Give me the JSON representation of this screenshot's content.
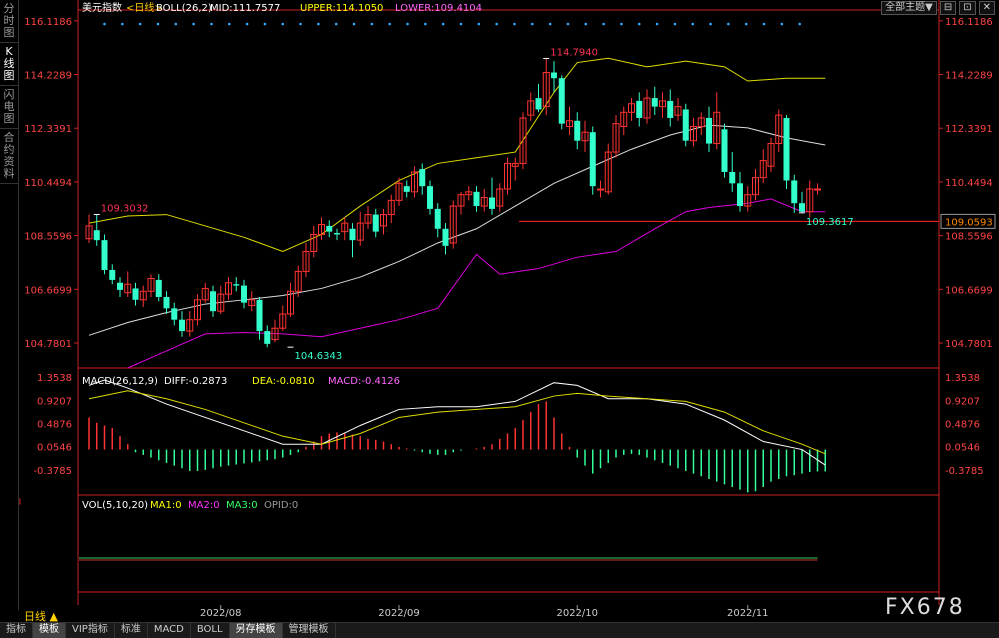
{
  "sidebar": {
    "tabs": [
      {
        "label": "分时图"
      },
      {
        "label": "K线图"
      },
      {
        "label": "闪电图"
      },
      {
        "label": "合约资料"
      }
    ]
  },
  "topbar": {
    "theme_button": "全部主题▼",
    "btn1": "⊟",
    "btn2": "⊡",
    "btn3": "✕"
  },
  "bottom": {
    "period_label": "日线 ▲",
    "tabs": [
      {
        "label": "指标"
      },
      {
        "label": "模板"
      },
      {
        "label": "VIP指标"
      },
      {
        "label": "标准"
      },
      {
        "label": "MACD"
      },
      {
        "label": "BOLL"
      },
      {
        "label": "另存模板"
      },
      {
        "label": "管理模板"
      }
    ],
    "watermark": "FX678"
  },
  "chart_data": {
    "type": "candlestick",
    "main": {
      "symbol": "美元指数",
      "period": "<日线>",
      "boll_label": "BOLL(26,2)",
      "mid_label": "MID:111.7577",
      "upper_label": "UPPER:114.1050",
      "lower_label": "LOWER:109.4104",
      "ylim": [
        103.9,
        116.5
      ],
      "yticks": [
        "116.1186",
        "114.2289",
        "112.3391",
        "110.4494",
        "108.5596",
        "106.6699",
        "104.7801"
      ],
      "current_price": "109.0593",
      "hline": 109.06,
      "annotations": [
        {
          "text": "114.7940",
          "index": 59,
          "value": 114.794
        },
        {
          "text": "109.3032",
          "index": 1,
          "value": 109.3032
        },
        {
          "text": "104.6343",
          "index": 26,
          "value": 104.6343
        },
        {
          "text": "109.3617",
          "index": 92,
          "value": 109.3617
        }
      ],
      "candles": [
        [
          108.45,
          108.9,
          108.3,
          109.3
        ],
        [
          108.75,
          108.4,
          108.2,
          109.3
        ],
        [
          108.4,
          107.35,
          107.2,
          108.6
        ],
        [
          107.35,
          107.0,
          106.85,
          107.55
        ],
        [
          106.9,
          106.65,
          106.4,
          107.1
        ],
        [
          106.55,
          106.85,
          106.4,
          107.3
        ],
        [
          106.7,
          106.3,
          106.1,
          106.9
        ],
        [
          106.3,
          106.6,
          106.05,
          106.8
        ],
        [
          106.6,
          107.05,
          106.4,
          107.2
        ],
        [
          107.0,
          106.4,
          106.25,
          107.2
        ],
        [
          106.4,
          106.0,
          105.8,
          106.6
        ],
        [
          106.0,
          105.6,
          105.4,
          106.2
        ],
        [
          105.6,
          105.2,
          105.0,
          105.9
        ],
        [
          105.2,
          105.6,
          105.0,
          105.9
        ],
        [
          105.6,
          106.3,
          105.4,
          106.5
        ],
        [
          106.3,
          106.7,
          106.2,
          106.9
        ],
        [
          106.6,
          105.9,
          105.7,
          106.8
        ],
        [
          105.9,
          106.5,
          105.8,
          106.8
        ],
        [
          106.5,
          106.9,
          106.3,
          107.1
        ],
        [
          106.85,
          106.8,
          106.6,
          107.1
        ],
        [
          106.8,
          106.2,
          106.0,
          107.0
        ],
        [
          106.1,
          106.3,
          105.9,
          106.6
        ],
        [
          106.3,
          105.2,
          104.9,
          106.4
        ],
        [
          105.2,
          104.75,
          104.63,
          105.4
        ],
        [
          104.9,
          105.3,
          104.8,
          105.6
        ],
        [
          105.3,
          105.8,
          105.2,
          106.1
        ],
        [
          105.8,
          106.6,
          105.7,
          106.9
        ],
        [
          106.6,
          107.3,
          106.4,
          107.5
        ],
        [
          107.3,
          108.0,
          107.1,
          108.3
        ],
        [
          108.0,
          108.6,
          107.8,
          108.9
        ],
        [
          108.6,
          108.95,
          108.4,
          109.2
        ],
        [
          108.9,
          108.7,
          108.5,
          109.1
        ],
        [
          108.65,
          108.6,
          108.4,
          108.8
        ],
        [
          108.7,
          109.0,
          108.4,
          109.2
        ],
        [
          108.8,
          108.4,
          107.8,
          109.0
        ],
        [
          108.4,
          109.0,
          108.2,
          109.4
        ],
        [
          109.0,
          109.3,
          108.8,
          109.6
        ],
        [
          109.3,
          108.7,
          108.5,
          109.5
        ],
        [
          108.9,
          109.3,
          108.6,
          109.5
        ],
        [
          109.3,
          109.8,
          109.0,
          110.0
        ],
        [
          109.8,
          110.4,
          109.6,
          110.6
        ],
        [
          110.3,
          110.1,
          109.9,
          110.5
        ],
        [
          110.1,
          110.8,
          109.9,
          111.0
        ],
        [
          110.9,
          110.3,
          110.0,
          111.1
        ],
        [
          110.3,
          109.5,
          109.3,
          110.5
        ],
        [
          109.5,
          108.8,
          108.5,
          109.7
        ],
        [
          108.8,
          108.2,
          107.9,
          109.0
        ],
        [
          108.3,
          109.6,
          108.1,
          109.8
        ],
        [
          109.6,
          110.0,
          109.3,
          110.1
        ],
        [
          110.0,
          110.1,
          109.8,
          110.3
        ],
        [
          110.1,
          109.6,
          109.4,
          110.3
        ],
        [
          109.6,
          109.9,
          109.4,
          110.2
        ],
        [
          109.9,
          109.5,
          109.3,
          110.6
        ],
        [
          109.6,
          110.2,
          109.4,
          110.4
        ],
        [
          110.2,
          111.1,
          110.0,
          111.3
        ],
        [
          111.0,
          111.1,
          110.5,
          111.3
        ],
        [
          111.1,
          112.7,
          110.9,
          112.9
        ],
        [
          112.8,
          113.3,
          112.6,
          113.6
        ],
        [
          113.4,
          113.0,
          112.9,
          113.9
        ],
        [
          113.1,
          114.3,
          112.8,
          114.79
        ],
        [
          114.3,
          114.1,
          113.6,
          114.7
        ],
        [
          114.1,
          112.5,
          112.3,
          114.2
        ],
        [
          112.4,
          112.6,
          112.1,
          113.1
        ],
        [
          112.6,
          111.9,
          111.6,
          112.9
        ],
        [
          111.9,
          112.2,
          111.5,
          112.6
        ],
        [
          112.2,
          110.3,
          110.0,
          112.4
        ],
        [
          110.2,
          110.2,
          109.9,
          110.5
        ],
        [
          110.1,
          111.5,
          110.0,
          111.8
        ],
        [
          111.5,
          112.5,
          111.3,
          112.8
        ],
        [
          112.4,
          112.9,
          112.1,
          113.1
        ],
        [
          112.9,
          113.2,
          112.6,
          113.4
        ],
        [
          113.3,
          112.7,
          112.4,
          113.6
        ],
        [
          112.7,
          113.4,
          112.5,
          113.7
        ],
        [
          113.4,
          113.1,
          112.8,
          113.8
        ],
        [
          113.1,
          113.3,
          112.7,
          113.6
        ],
        [
          113.3,
          112.7,
          112.4,
          113.7
        ],
        [
          112.8,
          113.1,
          112.6,
          113.4
        ],
        [
          113.0,
          111.9,
          111.7,
          113.2
        ],
        [
          111.9,
          112.4,
          111.7,
          112.7
        ],
        [
          112.4,
          112.7,
          112.1,
          112.9
        ],
        [
          112.7,
          111.8,
          111.5,
          113.1
        ],
        [
          111.8,
          112.9,
          111.6,
          113.6
        ],
        [
          112.3,
          110.8,
          110.6,
          112.5
        ],
        [
          110.8,
          110.4,
          110.1,
          111.5
        ],
        [
          110.4,
          109.6,
          109.4,
          110.8
        ],
        [
          109.6,
          110.0,
          109.4,
          110.3
        ],
        [
          110.0,
          110.6,
          109.8,
          110.9
        ],
        [
          110.6,
          111.2,
          110.4,
          111.6
        ],
        [
          111.0,
          111.8,
          110.8,
          112.0
        ],
        [
          111.8,
          112.8,
          111.5,
          113.0
        ],
        [
          112.7,
          110.5,
          110.2,
          112.8
        ],
        [
          110.5,
          109.7,
          109.36,
          110.7
        ],
        [
          109.7,
          109.4,
          109.36,
          110.1
        ],
        [
          109.4,
          110.2,
          109.2,
          110.5
        ],
        [
          110.2,
          110.2,
          110.0,
          110.4
        ]
      ],
      "mid": [
        [
          0,
          105.05
        ],
        [
          5,
          105.5
        ],
        [
          10,
          105.85
        ],
        [
          15,
          106.15
        ],
        [
          20,
          106.3
        ],
        [
          25,
          106.45
        ],
        [
          30,
          106.7
        ],
        [
          35,
          107.1
        ],
        [
          40,
          107.65
        ],
        [
          45,
          108.3
        ],
        [
          50,
          108.8
        ],
        [
          55,
          109.6
        ],
        [
          60,
          110.4
        ],
        [
          65,
          111.0
        ],
        [
          70,
          111.6
        ],
        [
          75,
          112.1
        ],
        [
          80,
          112.45
        ],
        [
          85,
          112.35
        ],
        [
          90,
          112.0
        ],
        [
          95,
          111.75
        ]
      ],
      "upper": [
        [
          0,
          109.0
        ],
        [
          5,
          109.25
        ],
        [
          10,
          109.3
        ],
        [
          15,
          108.9
        ],
        [
          20,
          108.5
        ],
        [
          25,
          108.0
        ],
        [
          30,
          108.6
        ],
        [
          35,
          109.6
        ],
        [
          40,
          110.5
        ],
        [
          45,
          111.1
        ],
        [
          50,
          111.3
        ],
        [
          55,
          111.5
        ],
        [
          60,
          113.6
        ],
        [
          63,
          114.65
        ],
        [
          67,
          114.8
        ],
        [
          72,
          114.5
        ],
        [
          77,
          114.7
        ],
        [
          82,
          114.5
        ],
        [
          85,
          114.0
        ],
        [
          90,
          114.1
        ],
        [
          95,
          114.1
        ]
      ],
      "lower": [
        [
          5,
          103.9
        ],
        [
          10,
          104.5
        ],
        [
          15,
          105.1
        ],
        [
          20,
          105.15
        ],
        [
          25,
          105.1
        ],
        [
          30,
          105.0
        ],
        [
          35,
          105.3
        ],
        [
          40,
          105.6
        ],
        [
          45,
          106.0
        ],
        [
          50,
          107.9
        ],
        [
          53,
          107.2
        ],
        [
          58,
          107.4
        ],
        [
          63,
          107.8
        ],
        [
          68,
          108.0
        ],
        [
          73,
          108.8
        ],
        [
          77,
          109.4
        ],
        [
          80,
          109.55
        ],
        [
          85,
          109.7
        ],
        [
          88,
          109.85
        ],
        [
          92,
          109.4
        ],
        [
          95,
          109.4
        ]
      ],
      "dots_count": 40
    },
    "macd": {
      "label": "MACD(26,12,9)",
      "diff_label": "DIFF:-0.2873",
      "dea_label": "DEA:-0.0810",
      "macd_label": "MACD:-0.4126",
      "ylim": [
        -0.85,
        1.45
      ],
      "yticks": [
        "1.3538",
        "0.9207",
        "0.4876",
        "0.0546",
        "-0.3785"
      ],
      "diff": [
        [
          0,
          1.2
        ],
        [
          2,
          1.3
        ],
        [
          5,
          1.15
        ],
        [
          10,
          0.85
        ],
        [
          15,
          0.6
        ],
        [
          20,
          0.35
        ],
        [
          25,
          0.1
        ],
        [
          30,
          0.1
        ],
        [
          35,
          0.45
        ],
        [
          40,
          0.75
        ],
        [
          45,
          0.8
        ],
        [
          50,
          0.8
        ],
        [
          55,
          0.9
        ],
        [
          60,
          1.25
        ],
        [
          63,
          1.2
        ],
        [
          67,
          0.95
        ],
        [
          72,
          0.95
        ],
        [
          77,
          0.85
        ],
        [
          82,
          0.55
        ],
        [
          87,
          0.15
        ],
        [
          92,
          0.0
        ],
        [
          95,
          -0.29
        ]
      ],
      "dea": [
        [
          0,
          0.95
        ],
        [
          5,
          1.1
        ],
        [
          10,
          0.95
        ],
        [
          15,
          0.75
        ],
        [
          20,
          0.5
        ],
        [
          25,
          0.25
        ],
        [
          30,
          0.1
        ],
        [
          35,
          0.3
        ],
        [
          40,
          0.6
        ],
        [
          45,
          0.7
        ],
        [
          50,
          0.75
        ],
        [
          55,
          0.8
        ],
        [
          60,
          1.0
        ],
        [
          63,
          1.05
        ],
        [
          67,
          1.0
        ],
        [
          72,
          0.95
        ],
        [
          77,
          0.9
        ],
        [
          82,
          0.7
        ],
        [
          87,
          0.35
        ],
        [
          92,
          0.1
        ],
        [
          95,
          -0.08
        ]
      ],
      "hist": [
        0.6,
        0.5,
        0.45,
        0.4,
        0.25,
        0.1,
        -0.05,
        -0.1,
        -0.15,
        -0.2,
        -0.25,
        -0.3,
        -0.35,
        -0.4,
        -0.4,
        -0.38,
        -0.35,
        -0.32,
        -0.3,
        -0.28,
        -0.26,
        -0.24,
        -0.22,
        -0.2,
        -0.18,
        -0.15,
        -0.1,
        -0.05,
        0.05,
        0.15,
        0.25,
        0.3,
        0.32,
        0.3,
        0.28,
        0.25,
        0.2,
        0.18,
        0.15,
        0.1,
        0.05,
        0.02,
        -0.02,
        -0.05,
        -0.08,
        -0.1,
        -0.1,
        -0.05,
        -0.02,
        0.0,
        0.02,
        0.05,
        0.1,
        0.2,
        0.3,
        0.4,
        0.55,
        0.7,
        0.85,
        0.9,
        0.6,
        0.3,
        0.05,
        -0.15,
        -0.3,
        -0.45,
        -0.35,
        -0.25,
        -0.15,
        -0.1,
        -0.08,
        -0.1,
        -0.15,
        -0.2,
        -0.25,
        -0.3,
        -0.35,
        -0.4,
        -0.45,
        -0.5,
        -0.55,
        -0.6,
        -0.65,
        -0.7,
        -0.75,
        -0.8,
        -0.78,
        -0.7,
        -0.6,
        -0.55,
        -0.5,
        -0.48,
        -0.45,
        -0.42,
        -0.41,
        -0.41
      ]
    },
    "vol": {
      "label": "VOL(5,10,20)",
      "ma1": "MA1:0",
      "ma2": "MA2:0",
      "ma3": "MA3:0",
      "opid": "OPID:0"
    },
    "xaxis": {
      "labels": [
        {
          "text": "2022/08",
          "index": 17
        },
        {
          "text": "2022/09",
          "index": 40
        },
        {
          "text": "2022/10",
          "index": 63
        },
        {
          "text": "2022/11",
          "index": 85
        }
      ]
    },
    "colors": {
      "up": "#ff3333",
      "down": "#33ffcc",
      "mid": "#dddddd",
      "upper": "#dddd00",
      "lower": "#dd00dd",
      "axis": "#cc2222",
      "title": "#ffffff",
      "upper_text": "#ffff00",
      "lower_text": "#ff66ff"
    }
  }
}
